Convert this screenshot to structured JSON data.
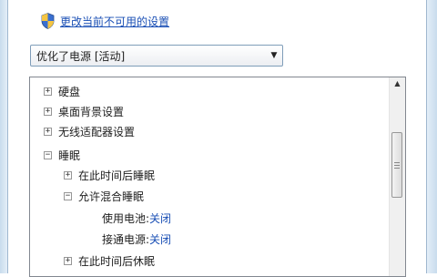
{
  "header": {
    "change_settings_link": "更改当前不可用的设置"
  },
  "plan_select": {
    "value": "优化了电源 [活动]"
  },
  "tree": {
    "items": [
      {
        "label": "硬盘",
        "expander": "+"
      },
      {
        "label": "桌面背景设置",
        "expander": "+"
      },
      {
        "label": "无线适配器设置",
        "expander": "+"
      },
      {
        "label": "睡眠",
        "expander": "−"
      },
      {
        "label": "在此时间后睡眠",
        "expander": "+"
      },
      {
        "label": "允许混合睡眠",
        "expander": "−"
      },
      {
        "label": "使用电池:",
        "value": "关闭"
      },
      {
        "label": "接通电源:",
        "value": "关闭"
      },
      {
        "label": "在此时间后休眠",
        "expander": "+"
      }
    ]
  },
  "colors": {
    "link": "#1a4fb5",
    "window_border": "#c9dced"
  }
}
